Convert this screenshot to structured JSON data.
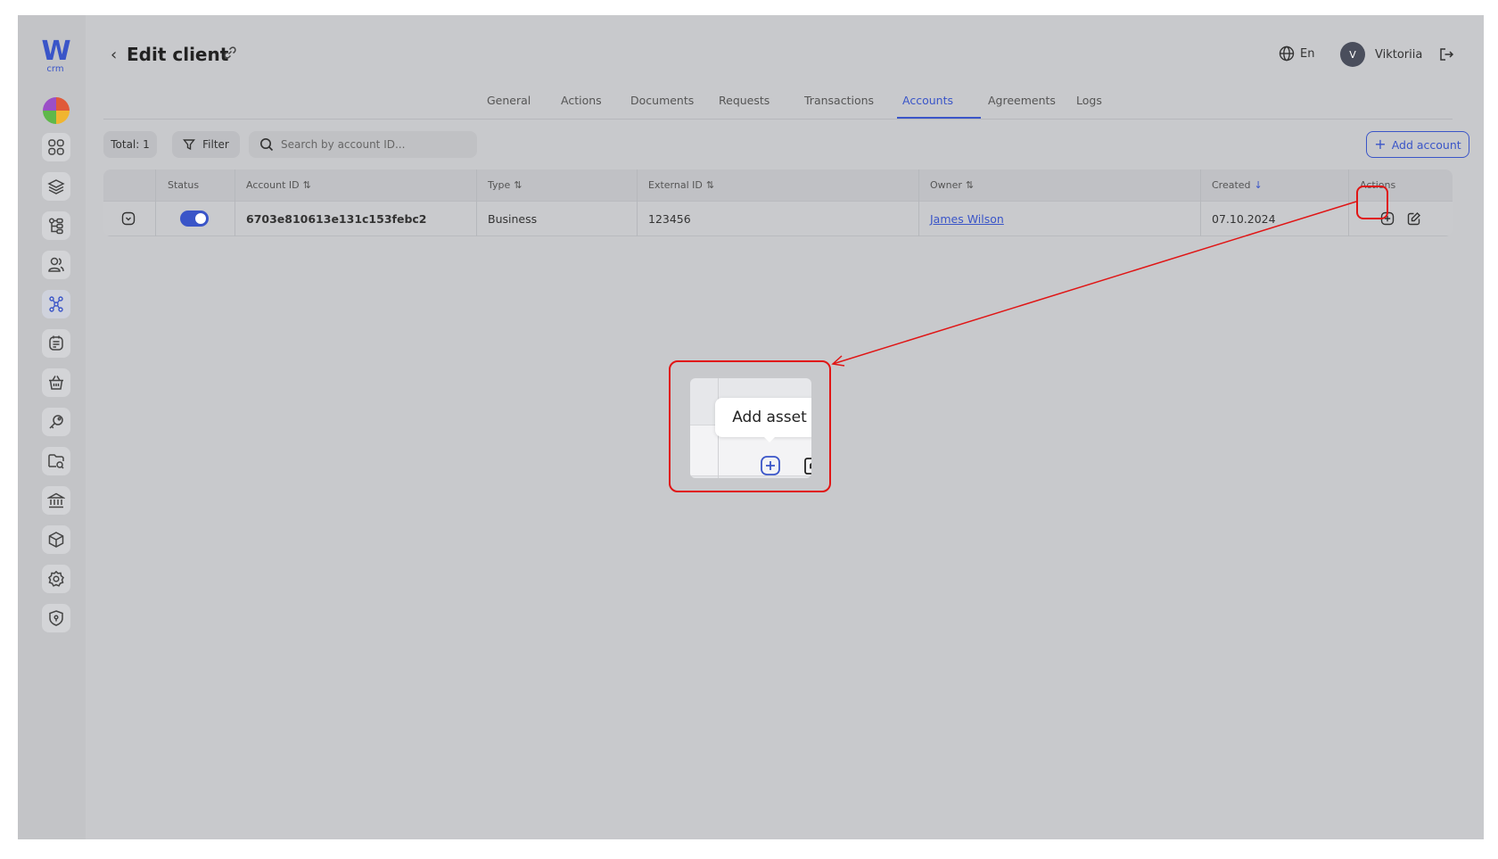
{
  "app": {
    "logo_mark": "W",
    "logo_sub": "crm"
  },
  "header": {
    "title": "Edit client",
    "language": "En",
    "user_initial": "V",
    "user_name": "Viktoriia"
  },
  "tabs": [
    {
      "label": "General"
    },
    {
      "label": "Actions"
    },
    {
      "label": "Documents"
    },
    {
      "label": "Requests"
    },
    {
      "label": "Transactions"
    },
    {
      "label": "Accounts",
      "active": true
    },
    {
      "label": "Agreements"
    },
    {
      "label": "Logs"
    }
  ],
  "toolbar": {
    "total_label": "Total: 1",
    "filter_label": "Filter",
    "search_placeholder": "Search by account ID...",
    "add_account_label": "Add account"
  },
  "table": {
    "columns": [
      "Status",
      "Account ID",
      "Type",
      "External ID",
      "Owner",
      "Created",
      "Actions"
    ],
    "rows": [
      {
        "status_on": true,
        "account_id": "6703e810613e131c153febc2",
        "type": "Business",
        "external_id": "123456",
        "owner": "James Wilson",
        "created": "07.10.2024"
      }
    ]
  },
  "zoom": {
    "tooltip": "Add asset"
  },
  "colors": {
    "accent": "#3a55c8",
    "annotation": "#e01515"
  },
  "sidebar": {
    "icons": [
      "dashboard-icon",
      "layers-icon",
      "hierarchy-icon",
      "users-icon",
      "groups-icon",
      "tasks-icon",
      "basket-icon",
      "key-icon",
      "folder-icon",
      "bank-icon",
      "cube-icon",
      "settings-icon",
      "shield-icon"
    ]
  }
}
